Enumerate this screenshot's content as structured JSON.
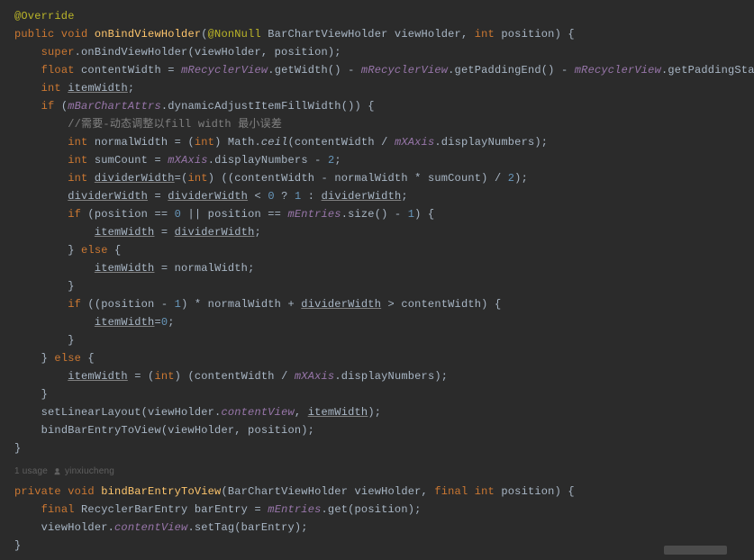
{
  "annotation": "@Override",
  "sig1": {
    "mod": "public void",
    "name": "onBindViewHolder",
    "anno": "@NonNull",
    "p1type": "BarChartViewHolder",
    "p1": "viewHolder",
    "p2mod": "int",
    "p2": "position"
  },
  "l2": {
    "a": "super",
    "b": ".onBindViewHolder(viewHolder, position);"
  },
  "l3": {
    "t": "float",
    "v": "contentWidth",
    "eq": " = ",
    "f1": "mRecyclerView",
    "m1": ".getWidth() - ",
    "f2": "mRecyclerView",
    "m2": ".getPaddingEnd() - ",
    "f3": "mRecyclerView",
    "m3": ".getPaddingStart();"
  },
  "l4": {
    "t": "int",
    "v": "itemWidth",
    "end": ";"
  },
  "l5": {
    "kw": "if",
    "open": " (",
    "f": "mBarChartAttrs",
    "m": ".dynamicAdjustItemFillWidth()) {"
  },
  "l6": "//需要-动态调整以fill width 最小误差",
  "l7": {
    "t": "int",
    "v": "normalWidth",
    "eq": " = (",
    "cast": "int",
    "close": ") Math.",
    "call": "ceil",
    "args": "(contentWidth / ",
    "f": "mXAxis",
    "m": ".displayNumbers);"
  },
  "l8": {
    "t": "int",
    "v": "sumCount",
    "eq": " = ",
    "f": "mXAxis",
    "m": ".displayNumbers - ",
    "n": "2",
    "end": ";"
  },
  "l9": {
    "t": "int",
    "v": "dividerWidth",
    "eq": "=(",
    "cast": "int",
    "mid": ") ((contentWidth - normalWidth * sumCount) / ",
    "n": "2",
    "end": ");"
  },
  "l10": {
    "a": "dividerWidth",
    "eq": " = ",
    "b": "dividerWidth",
    "lt": " < ",
    "n0": "0",
    "q": " ? ",
    "n1": "1",
    "c": " : ",
    "d": "dividerWidth",
    "end": ";"
  },
  "l11": {
    "kw": "if",
    "open": " (position == ",
    "n0": "0",
    "or": " || position == ",
    "f": "mEntries",
    "m": ".size() - ",
    "n1": "1",
    "end": ") {"
  },
  "l12": {
    "a": "itemWidth",
    "eq": " = ",
    "b": "dividerWidth",
    "end": ";"
  },
  "l13": {
    "close": "} ",
    "kw": "else",
    "open": " {"
  },
  "l14": {
    "a": "itemWidth",
    "eq": " = normalWidth;"
  },
  "l15": "}",
  "l16": {
    "kw": "if",
    "open": " ((position - ",
    "n": "1",
    "mid": ") * normalWidth + ",
    "v": "dividerWidth",
    "gt": " > contentWidth) {"
  },
  "l17": {
    "a": "itemWidth",
    "eq": "=",
    "n": "0",
    "end": ";"
  },
  "l18": "}",
  "l19": {
    "close": "} ",
    "kw": "else",
    "open": " {"
  },
  "l20": {
    "a": "itemWidth",
    "eq": " = (",
    "cast": "int",
    "mid": ") (contentWidth / ",
    "f": "mXAxis",
    "m": ".displayNumbers);"
  },
  "l21": "}",
  "l22": {
    "call": "setLinearLayout(viewHolder.",
    "f": "contentView",
    "mid": ", ",
    "v": "itemWidth",
    "end": ");"
  },
  "l23": "bindBarEntryToView(viewHolder, position);",
  "l24": "}",
  "usages": {
    "count": "1 usage",
    "author": "yinxiucheng"
  },
  "sig2": {
    "mod": "private void",
    "name": "bindBarEntryToView",
    "p1type": "BarChartViewHolder",
    "p1": "viewHolder",
    "p2mod": "final int",
    "p2": "position"
  },
  "l26": {
    "kw": "final",
    "t": "RecyclerBarEntry",
    "v": "barEntry",
    "eq": " = ",
    "f": "mEntries",
    "m": ".get(position);"
  },
  "l27": {
    "a": "viewHolder.",
    "f": "contentView",
    "m": ".setTag(barEntry);"
  },
  "l28": "}"
}
